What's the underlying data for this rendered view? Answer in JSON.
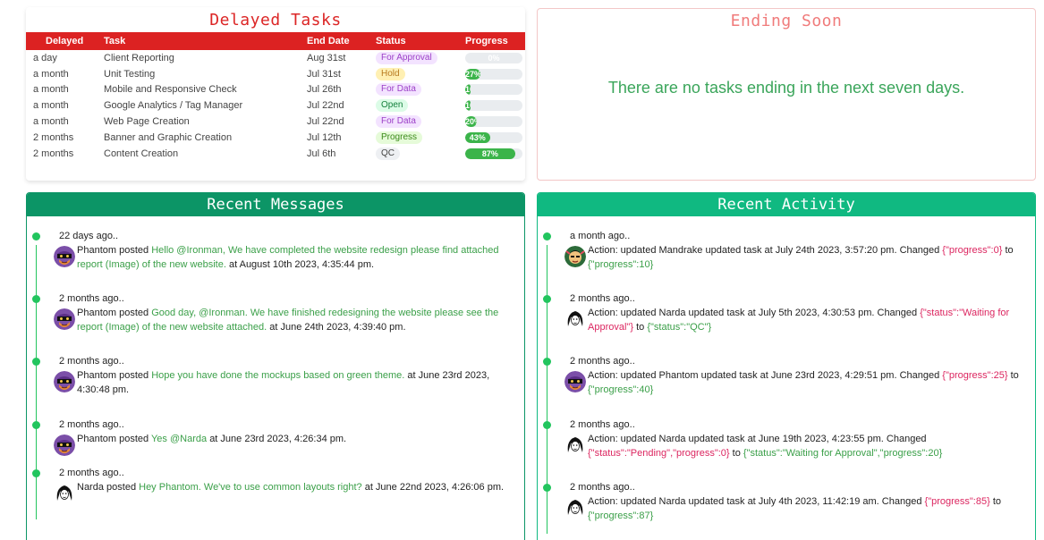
{
  "delayed_tasks": {
    "title": "Delayed Tasks",
    "columns": [
      "Delayed",
      "Task",
      "End Date",
      "Status",
      "Progress"
    ],
    "rows": [
      {
        "delayed": "a day",
        "task": "Client Reporting",
        "end": "Aug 31st",
        "status": "For Approval",
        "status_color": "#f3e3ff",
        "status_text": "#9b3fc7",
        "progress": 0,
        "label": "0%"
      },
      {
        "delayed": "a month",
        "task": "Unit Testing",
        "end": "Jul 31st",
        "status": "Hold",
        "status_color": "#fff0b3",
        "status_text": "#b7791f",
        "progress": 27,
        "label": "27%"
      },
      {
        "delayed": "a month",
        "task": "Mobile and Responsive Check",
        "end": "Jul 26th",
        "status": "For Data",
        "status_color": "#f3e3ff",
        "status_text": "#9b3fc7",
        "progress": 10,
        "label": "10%"
      },
      {
        "delayed": "a month",
        "task": "Google Analytics / Tag Manager",
        "end": "Jul 22nd",
        "status": "Open",
        "status_color": "#dcfce7",
        "status_text": "#15803d",
        "progress": 10,
        "label": "10%"
      },
      {
        "delayed": "a month",
        "task": "Web Page Creation",
        "end": "Jul 22nd",
        "status": "For Data",
        "status_color": "#f3e3ff",
        "status_text": "#9b3fc7",
        "progress": 20,
        "label": "20%"
      },
      {
        "delayed": "2 months",
        "task": "Banner and Graphic Creation",
        "end": "Jul 12th",
        "status": "Progress",
        "status_color": "#e6fbd9",
        "status_text": "#3b8a1a",
        "progress": 43,
        "label": "43%"
      },
      {
        "delayed": "2 months",
        "task": "Content Creation",
        "end": "Jul 6th",
        "status": "QC",
        "status_color": "#eef0f3",
        "status_text": "#444444",
        "progress": 87,
        "label": "87%"
      }
    ]
  },
  "ending_soon": {
    "title": "Ending Soon",
    "message": "There are no tasks ending in the next seven days."
  },
  "messages": {
    "title": "Recent Messages",
    "items": [
      {
        "when": "22 days ago..",
        "author": "Phantom",
        "verb": "posted",
        "text": "Hello @Ironman, We have completed the website redesign please find attached report (Image) of the new website.",
        "at": "at August 10th 2023, 4:35:44 pm.",
        "avatar": "phantom-avatar-icon"
      },
      {
        "when": "2 months ago..",
        "author": "Phantom",
        "verb": "posted",
        "text": "Good day, @Ironman. We have finished redesigning the website please see the report (Image) of the new website attached.",
        "at": "at June 24th 2023, 4:39:40 pm.",
        "avatar": "phantom-avatar-icon"
      },
      {
        "when": "2 months ago..",
        "author": "Phantom",
        "verb": "posted",
        "text": "Hope you have done the mockups based on green theme.",
        "at": "at June 23rd 2023, 4:30:48 pm.",
        "avatar": "phantom-avatar-icon"
      },
      {
        "when": "2 months ago..",
        "author": "Phantom",
        "verb": "posted",
        "text": "Yes @Narda",
        "at": "at June 23rd 2023, 4:26:34 pm.",
        "avatar": "phantom-avatar-icon"
      },
      {
        "when": "2 months ago..",
        "author": "Narda",
        "verb": "posted",
        "text": "Hey Phantom. We've to use common layouts right?",
        "at": "at June 22nd 2023, 4:26:06 pm.",
        "avatar": "narda-avatar-icon"
      }
    ]
  },
  "activity": {
    "title": "Recent Activity",
    "items": [
      {
        "when": "a month ago..",
        "text": "Action: updated  Mandrake updated task at July 24th 2023, 3:57:20 pm.  Changed",
        "from": "{\"progress\":0}",
        "to_word": "to",
        "to": "{\"progress\":10}",
        "avatar": "mandrake-avatar-icon"
      },
      {
        "when": "2 months ago..",
        "text": "Action: updated  Narda updated task at July 5th 2023, 4:30:53 pm.  Changed",
        "from": "{\"status\":\"Waiting for Approval\"}",
        "to_word": "to",
        "to": "{\"status\":\"QC\"}",
        "avatar": "narda-avatar-icon"
      },
      {
        "when": "2 months ago..",
        "text": "Action: updated  Phantom updated task at June 23rd 2023, 4:29:51 pm.  Changed",
        "from": "{\"progress\":25}",
        "to_word": "to",
        "to": "{\"progress\":40}",
        "avatar": "phantom-avatar-icon"
      },
      {
        "when": "2 months ago..",
        "text": "Action: updated  Narda updated task at June 19th 2023, 4:23:55 pm.  Changed",
        "from": "{\"status\":\"Pending\",\"progress\":0}",
        "to_word": "to",
        "to": "{\"status\":\"Waiting for Approval\",\"progress\":20}",
        "avatar": "narda-avatar-icon"
      },
      {
        "when": "2 months ago..",
        "text": "Action: updated  Narda updated task at July 4th 2023, 11:42:19 am.  Changed",
        "from": "{\"progress\":85}",
        "to_word": "to",
        "to": "{\"progress\":87}",
        "avatar": "narda-avatar-icon"
      }
    ]
  },
  "colors": {
    "danger": "#dc2222",
    "success": "#10b981",
    "accent_green": "#22c55e"
  }
}
